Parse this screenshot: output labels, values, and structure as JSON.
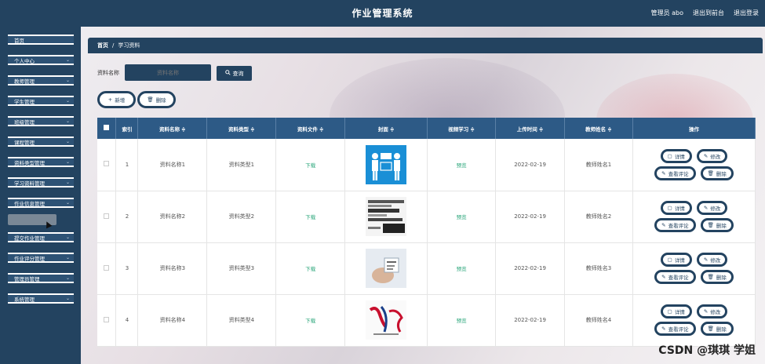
{
  "app": {
    "title": "作业管理系统",
    "admin_label": "管理员 abo",
    "to_front_label": "退出到前台",
    "logout_label": "退出登录"
  },
  "sidebar": {
    "items": [
      {
        "label": "首页",
        "has_chevron": false
      },
      {
        "label": "个人中心",
        "has_chevron": true
      },
      {
        "label": "教师管理",
        "has_chevron": true
      },
      {
        "label": "学生管理",
        "has_chevron": true
      },
      {
        "label": "班级管理",
        "has_chevron": true
      },
      {
        "label": "课程管理",
        "has_chevron": true
      },
      {
        "label": "资料类型管理",
        "has_chevron": true
      },
      {
        "label": "学习资料管理",
        "has_chevron": true
      },
      {
        "label": "作业信息管理",
        "has_chevron": true
      },
      {
        "label": "提交作业管理",
        "has_chevron": true
      },
      {
        "label": "作业评分管理",
        "has_chevron": true
      },
      {
        "label": "管理员管理",
        "has_chevron": true
      },
      {
        "label": "系统管理",
        "has_chevron": true
      }
    ],
    "chevron": "chevron-down-icon"
  },
  "breadcrumb": {
    "home": "首页",
    "separator": "/",
    "current": "学习资料"
  },
  "search": {
    "label": "资料名称",
    "placeholder": "资料名称",
    "button_label": "查询",
    "button_icon": "search-icon"
  },
  "actions": {
    "add_label": "新增",
    "delete_label": "删除"
  },
  "table": {
    "headers": [
      "索引",
      "资料名称 ≑",
      "资料类型 ≑",
      "资料文件 ≑",
      "封面 ≑",
      "视频学习 ≑",
      "上传时间 ≑",
      "教师姓名 ≑",
      "操作"
    ],
    "rows": [
      {
        "index": "1",
        "name": "资料名称1",
        "type": "资料类型1",
        "file": "下载",
        "cover": "english-cover",
        "video": "预览",
        "time": "2022-02-19",
        "teacher": "教师姓名1"
      },
      {
        "index": "2",
        "name": "资料名称2",
        "type": "资料类型2",
        "file": "下载",
        "cover": "words-cover",
        "video": "预览",
        "time": "2022-02-19",
        "teacher": "教师姓名2"
      },
      {
        "index": "3",
        "name": "资料名称3",
        "type": "资料类型3",
        "file": "下载",
        "cover": "hand-cover",
        "video": "预览",
        "time": "2022-02-19",
        "teacher": "教师姓名3"
      },
      {
        "index": "4",
        "name": "资料名称4",
        "type": "资料类型4",
        "file": "下载",
        "cover": "calligraphy-cover",
        "video": "预览",
        "time": "2022-02-19",
        "teacher": "教师姓名4"
      }
    ],
    "op_labels": {
      "detail": "详情",
      "edit": "修改",
      "comments": "查看评论",
      "delete": "删除"
    }
  },
  "watermark": "CSDN @琪琪 学姐",
  "colors": {
    "navy": "#234360",
    "table_header": "#2d5a86",
    "green_link": "#2aa67a"
  }
}
